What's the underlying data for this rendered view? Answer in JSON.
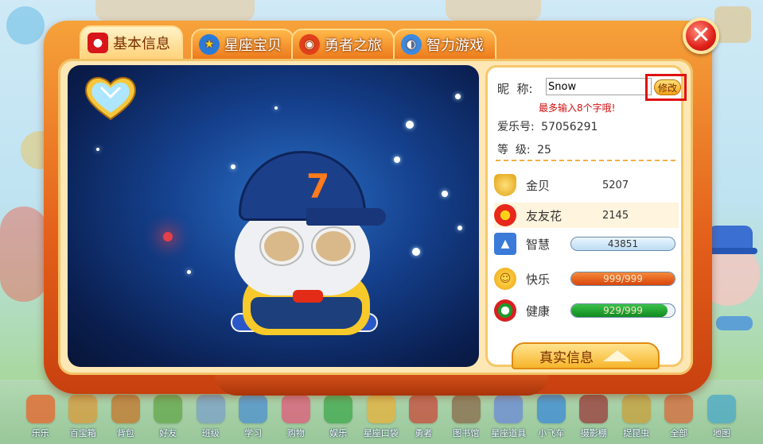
{
  "tabs": [
    {
      "label": "基本信息",
      "icon": "bag-icon",
      "active": true
    },
    {
      "label": "星座宝贝",
      "icon": "star-icon",
      "active": false
    },
    {
      "label": "勇者之旅",
      "icon": "medal-icon",
      "active": false
    },
    {
      "label": "智力游戏",
      "icon": "globe-icon",
      "active": false
    }
  ],
  "profile": {
    "nick_label": "昵  称:",
    "nick_value": "Snow",
    "edit_label": "修改",
    "nick_hint": "最多输入8个字哦!",
    "id_label": "爱乐号:",
    "id_value": "57056291",
    "level_label": "等  级:",
    "level_value": "25"
  },
  "stats": {
    "gold": {
      "label": "金贝",
      "value": "5207",
      "icon": "shell-icon"
    },
    "flower": {
      "label": "友友花",
      "value": "2145",
      "icon": "flower-icon"
    },
    "wisdom": {
      "label": "智慧",
      "value": "43851",
      "fill": 1.0,
      "icon": "graduation-cap-icon"
    },
    "happy": {
      "label": "快乐",
      "value": "999/999",
      "fill": 1.0,
      "icon": "smiley-icon"
    },
    "health": {
      "label": "健康",
      "value": "929/999",
      "fill": 0.93,
      "icon": "health-icon"
    }
  },
  "real_info_label": "真实信息",
  "toolbar": [
    {
      "label": "乐乐",
      "color": "#e9632a"
    },
    {
      "label": "百宝箱",
      "color": "#d99a3a"
    },
    {
      "label": "背包",
      "color": "#c5762b"
    },
    {
      "label": "好友",
      "color": "#62a74a"
    },
    {
      "label": "班级",
      "color": "#7aa0c8"
    },
    {
      "label": "学习",
      "color": "#4c8fd0"
    },
    {
      "label": "购物",
      "color": "#e05a7a"
    },
    {
      "label": "娱乐",
      "color": "#3ea84c"
    },
    {
      "label": "星座口袋",
      "color": "#e8b23a"
    },
    {
      "label": "勇者",
      "color": "#c84a3a"
    },
    {
      "label": "图书馆",
      "color": "#8a6a4a"
    },
    {
      "label": "星座道具",
      "color": "#6a8ad8"
    },
    {
      "label": "小飞车",
      "color": "#3a8ad8"
    },
    {
      "label": "摄影棚",
      "color": "#9a3a3a"
    },
    {
      "label": "捉昆虫",
      "color": "#c8a03a"
    },
    {
      "label": "全部",
      "color": "#d86a3a"
    },
    {
      "label": "地图",
      "color": "#4aa8c8"
    }
  ],
  "colors": {
    "frame_orange": "#e35e1a",
    "wisdom_bar": "#2f8fe0",
    "happy_bar": "#e65a10",
    "health_bar": "#1c9a2c",
    "highlight_red": "#e01010"
  }
}
